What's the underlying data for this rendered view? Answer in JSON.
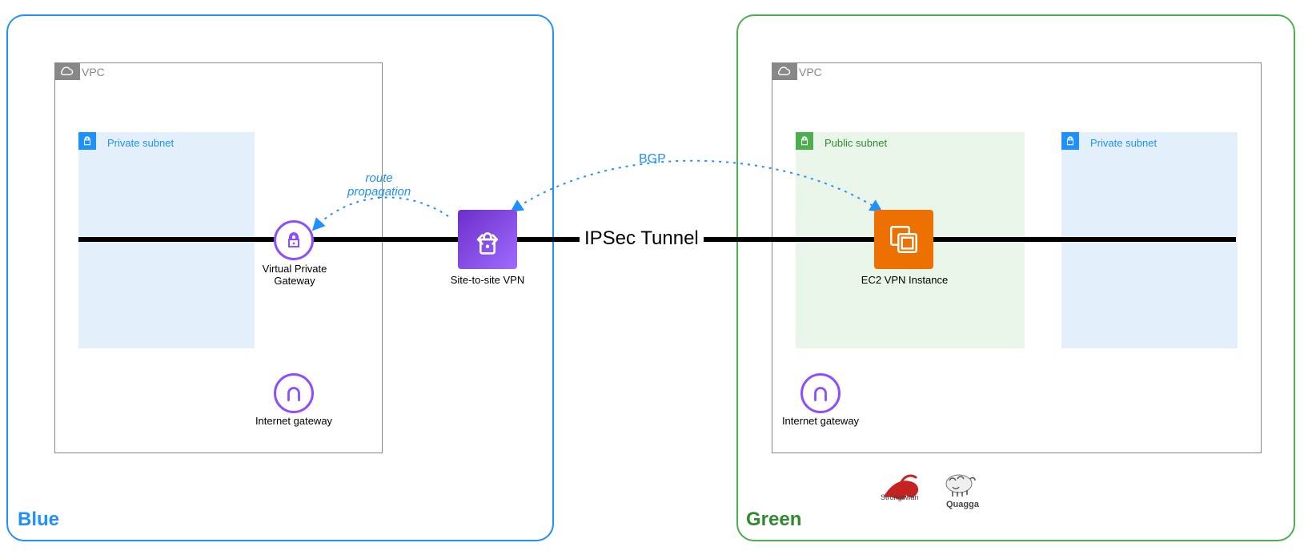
{
  "regions": {
    "blue": {
      "label": "Blue",
      "color": "#1e90ff"
    },
    "green": {
      "label": "Green",
      "color": "#4cae4c"
    }
  },
  "vpc_label": "VPC",
  "subnets": {
    "blue_private": {
      "label": "Private subnet",
      "bg": "#e3f0fb",
      "accent": "#1e90ff"
    },
    "green_public": {
      "label": "Public subnet",
      "bg": "#eaf5e9",
      "accent": "#4cae4c"
    },
    "green_private": {
      "label": "Private subnet",
      "bg": "#e3f0fb",
      "accent": "#1e90ff"
    }
  },
  "nodes": {
    "vgw": {
      "label": "Virtual Private\nGateway"
    },
    "s2s": {
      "label": "Site-to-site VPN"
    },
    "ec2": {
      "label": "EC2 VPN Instance"
    },
    "igw": {
      "label": "Internet gateway"
    }
  },
  "connections": {
    "tunnel": {
      "label": "IPSec Tunnel"
    },
    "bgp": {
      "label": "BGP"
    },
    "route_prop": {
      "label": "route\npropagation"
    }
  },
  "brands": {
    "strongswan": "Strongswan",
    "quagga": "Quagga"
  }
}
